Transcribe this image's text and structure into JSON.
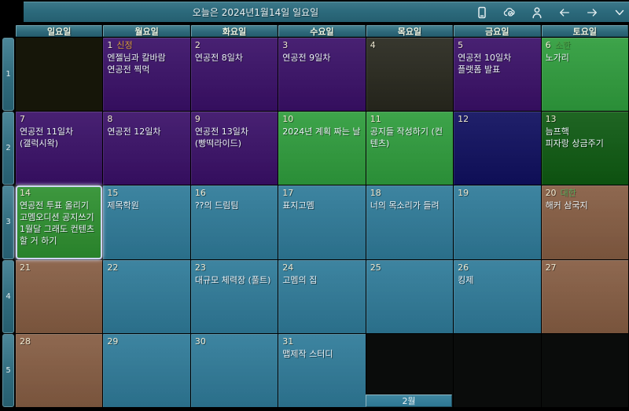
{
  "titlebar": {
    "title": "오늘은 2024년1월14일 일요일",
    "icons": [
      "phone",
      "cloud-sync",
      "person",
      "arrow-left",
      "arrow-right",
      "chevron-down"
    ]
  },
  "weekday_headers": [
    "일요일",
    "월요일",
    "화요일",
    "수요일",
    "목요일",
    "금요일",
    "토요일"
  ],
  "week_numbers": [
    "1",
    "2",
    "3",
    "4",
    "5"
  ],
  "footer": {
    "next_month_label": "2월"
  },
  "colors": {
    "titlebar": "#2d6b7d",
    "purple": "#3a1068",
    "green": "#2f9d3d",
    "green_today": "#2e9030",
    "darkgreen": "#0e5a12",
    "navy": "#0f0f5f",
    "teal": "#2f7b99",
    "brown": "#865d43",
    "dark": "#161609",
    "gray": "#28281e",
    "black": "#0a0c0b",
    "holiday_newyear": "#d79b3a",
    "holiday_term_green": "#4d9a43",
    "holiday_term_brown": "#59a759",
    "today_border": "#cfd4f2"
  },
  "cells": [
    {
      "type": "dark",
      "day": "",
      "holiday": "",
      "events": []
    },
    {
      "type": "purple",
      "day": "1",
      "holiday": "신정",
      "holiday_color": "#d79b3a",
      "events": [
        "엔젤님과 칼바람",
        "연공전 찍먹"
      ]
    },
    {
      "type": "purple",
      "day": "2",
      "holiday": "",
      "events": [
        "연공전 8일차"
      ]
    },
    {
      "type": "purple",
      "day": "3",
      "holiday": "",
      "events": [
        "연공전 9일차"
      ]
    },
    {
      "type": "gray",
      "day": "4",
      "holiday": "",
      "events": []
    },
    {
      "type": "purple",
      "day": "5",
      "holiday": "",
      "events": [
        "연공전 10일차",
        "플랫폼 발표"
      ]
    },
    {
      "type": "green",
      "day": "6",
      "holiday": "소한",
      "holiday_color": "#4d9a43",
      "events": [
        "노가리"
      ]
    },
    {
      "type": "purple",
      "day": "7",
      "holiday": "",
      "events": [
        "연공전 11일차",
        "(갤럭시왁)"
      ]
    },
    {
      "type": "purple",
      "day": "8",
      "holiday": "",
      "events": [
        "연공전 12일차"
      ]
    },
    {
      "type": "purple",
      "day": "9",
      "holiday": "",
      "events": [
        "연공전 13일차",
        "(빵떡라이드)"
      ]
    },
    {
      "type": "green",
      "day": "10",
      "holiday": "",
      "events": [
        "2024년 계획 짜는 날"
      ]
    },
    {
      "type": "green",
      "day": "11",
      "holiday": "",
      "events": [
        "공지들 작성하기 (컨텐츠)"
      ]
    },
    {
      "type": "navy",
      "day": "12",
      "holiday": "",
      "events": []
    },
    {
      "type": "darkgreen",
      "day": "13",
      "holiday": "",
      "events": [
        "늠프핵",
        "피자랑 상금주기"
      ]
    },
    {
      "type": "green_today",
      "day": "14",
      "holiday": "",
      "today": true,
      "events": [
        "연공전 투표 올리기",
        "고멤오디션 공지쓰기",
        "1월달 그래도 컨텐츠할 거 하기"
      ]
    },
    {
      "type": "teal",
      "day": "15",
      "holiday": "",
      "events": [
        "제목학원"
      ]
    },
    {
      "type": "teal",
      "day": "16",
      "holiday": "",
      "events": [
        "??의 드림팀"
      ]
    },
    {
      "type": "teal",
      "day": "17",
      "holiday": "",
      "events": [
        "표지고멤"
      ]
    },
    {
      "type": "teal",
      "day": "18",
      "holiday": "",
      "events": [
        "너의 목소리가 들려"
      ]
    },
    {
      "type": "teal",
      "day": "19",
      "holiday": "",
      "events": []
    },
    {
      "type": "brown",
      "day": "20",
      "holiday": "대한",
      "holiday_color": "#59a759",
      "events": [
        "해커 삼국지"
      ]
    },
    {
      "type": "brown",
      "day": "21",
      "holiday": "",
      "events": []
    },
    {
      "type": "teal",
      "day": "22",
      "holiday": "",
      "events": []
    },
    {
      "type": "teal",
      "day": "23",
      "holiday": "",
      "events": [
        "대규모 체력장 (풀트)"
      ]
    },
    {
      "type": "teal",
      "day": "24",
      "holiday": "",
      "events": [
        "고멤의 집"
      ]
    },
    {
      "type": "teal",
      "day": "25",
      "holiday": "",
      "events": []
    },
    {
      "type": "teal",
      "day": "26",
      "holiday": "",
      "events": [
        "킹제"
      ]
    },
    {
      "type": "brown",
      "day": "27",
      "holiday": "",
      "events": []
    },
    {
      "type": "brown",
      "day": "28",
      "holiday": "",
      "events": []
    },
    {
      "type": "teal",
      "day": "29",
      "holiday": "",
      "events": []
    },
    {
      "type": "teal",
      "day": "30",
      "holiday": "",
      "events": []
    },
    {
      "type": "teal",
      "day": "31",
      "holiday": "",
      "events": [
        "맵제작 스터디"
      ]
    },
    {
      "type": "black",
      "day": "",
      "holiday": "",
      "events": []
    },
    {
      "type": "black",
      "day": "",
      "holiday": "",
      "events": []
    },
    {
      "type": "black",
      "day": "",
      "holiday": "",
      "events": []
    }
  ]
}
